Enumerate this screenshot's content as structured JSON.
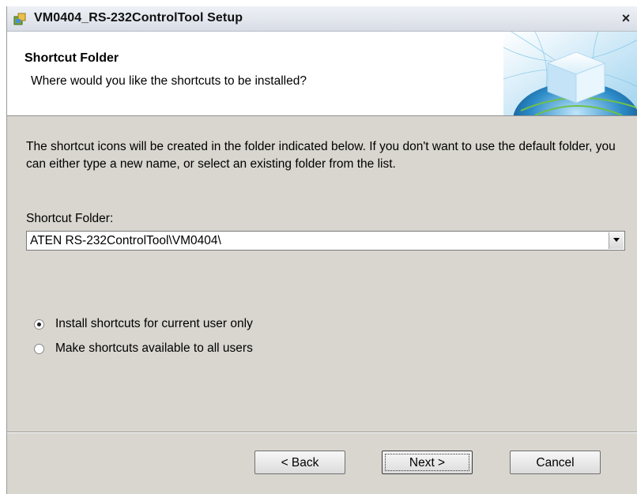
{
  "window": {
    "title": "VM0404_RS-232ControlTool Setup",
    "close_symbol": "×"
  },
  "header": {
    "title": "Shortcut Folder",
    "subtitle": "Where would you like the shortcuts to be installed?"
  },
  "body": {
    "description": "The shortcut icons will be created in the folder indicated below. If you don't want to use the default folder, you can either type a new name, or select an existing folder from the list.",
    "folder_label": "Shortcut Folder:",
    "folder_value": "ATEN RS-232ControlTool\\VM0404\\"
  },
  "options": [
    {
      "label": "Install shortcuts for current user only",
      "selected": true
    },
    {
      "label": "Make shortcuts available to all users",
      "selected": false
    }
  ],
  "buttons": {
    "back": "< Back",
    "next": "Next >",
    "cancel": "Cancel"
  },
  "icons": {
    "app": "installer-icon",
    "close": "close-icon",
    "dropdown": "chevron-down-icon",
    "banner": "globe-cube-graphic"
  },
  "colors": {
    "dialog_background": "#d9d6cf",
    "header_background": "#ffffff",
    "banner_accent": "#4aa8d8"
  }
}
